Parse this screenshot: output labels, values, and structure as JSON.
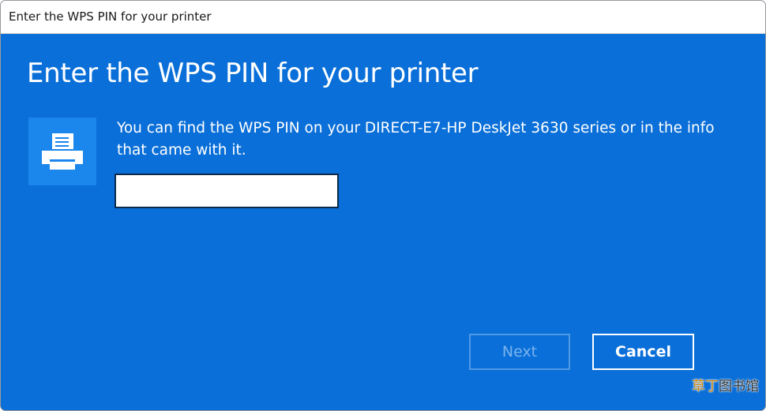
{
  "window": {
    "title": "Enter the WPS PIN for your printer"
  },
  "dialog": {
    "heading": "Enter the WPS PIN for your printer",
    "printer_icon": "printer-icon",
    "instructions": "You can find the WPS PIN on your DIRECT-E7-HP DeskJet 3630 series or in the info that came with it.",
    "pin_value": "",
    "pin_placeholder": ""
  },
  "buttons": {
    "next_label": "Next",
    "next_enabled": false,
    "cancel_label": "Cancel"
  },
  "watermark": {
    "part1": "草丁",
    "part2": "图书馆"
  },
  "colors": {
    "background": "#0a6fd8",
    "tile": "#1b86ec",
    "text": "#ffffff"
  }
}
